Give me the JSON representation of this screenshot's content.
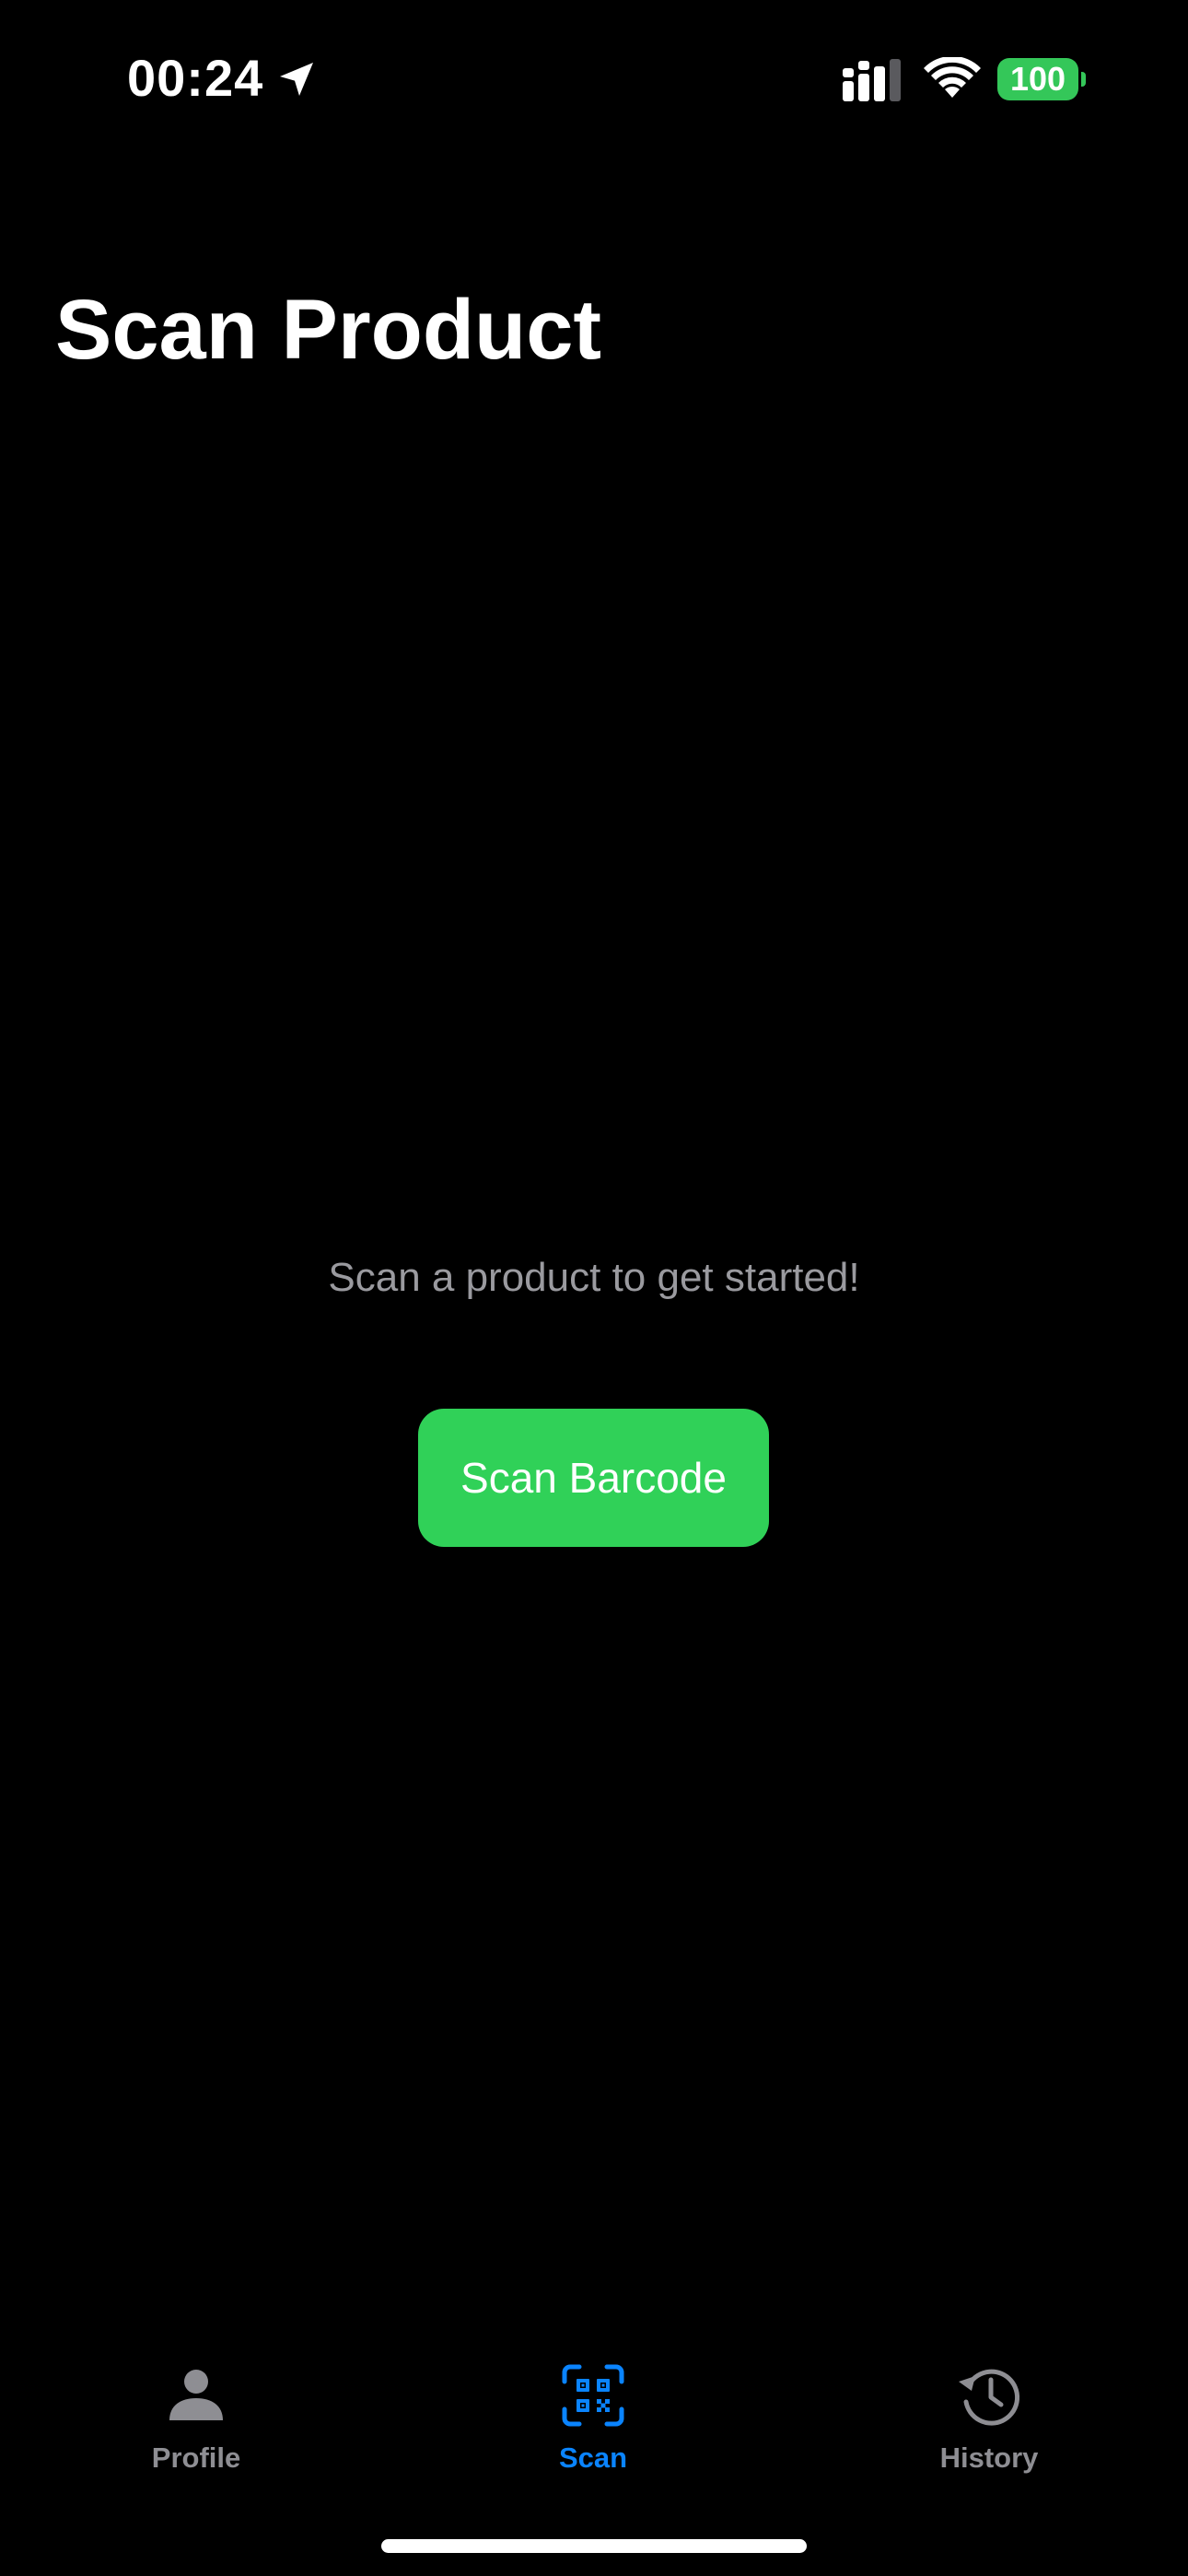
{
  "status_bar": {
    "time": "00:24",
    "battery_level": "100",
    "icons": [
      "location-arrow-icon",
      "cellular-signal-icon",
      "wifi-icon",
      "battery-icon"
    ]
  },
  "page": {
    "title": "Scan Product"
  },
  "main": {
    "empty_message": "Scan a product to get started!",
    "scan_button_label": "Scan Barcode"
  },
  "tab_bar": {
    "selected": "Scan",
    "tabs": [
      {
        "label": "Profile",
        "icon": "person-icon",
        "active": false
      },
      {
        "label": "Scan",
        "icon": "qr-code-scan-icon",
        "active": true
      },
      {
        "label": "History",
        "icon": "history-clock-icon",
        "active": false
      }
    ]
  },
  "colors": {
    "background": "#000000",
    "accent_green": "#30d158",
    "battery_green": "#34c759",
    "active_tab": "#0a84ff",
    "inactive_tab": "#8e8e93",
    "secondary_text": "#9a9a9f"
  }
}
